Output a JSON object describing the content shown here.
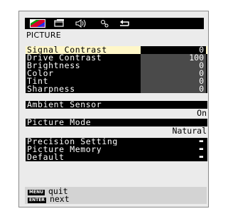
{
  "tabs": [
    {
      "name": "picture-tab-icon",
      "active": true
    },
    {
      "name": "display-tab-icon",
      "active": false
    },
    {
      "name": "audio-tab-icon",
      "active": false
    },
    {
      "name": "setup-tab-icon",
      "active": false
    },
    {
      "name": "return-tab-icon",
      "active": false
    }
  ],
  "section_title": "PICTURE",
  "items": [
    {
      "label": "Signal Contrast",
      "value": "0",
      "selected": true
    },
    {
      "label": "Drive Contrast",
      "value": "100"
    },
    {
      "label": "Brightness",
      "value": "0"
    },
    {
      "label": "Color",
      "value": "0"
    },
    {
      "label": "Tint",
      "value": "0"
    },
    {
      "label": "Sharpness",
      "value": "0"
    }
  ],
  "ambient": {
    "label": "Ambient Sensor",
    "value": "On"
  },
  "mode": {
    "label": "Picture Mode",
    "value": "Natural"
  },
  "submenus": [
    {
      "label": "Precision Setting",
      "arrow": "▬"
    },
    {
      "label": "Picture Memory",
      "arrow": "▬"
    },
    {
      "label": "Default",
      "arrow": "▬"
    }
  ],
  "help": {
    "menu_key": "MENU",
    "menu_text": "quit",
    "enter_key": "ENTER",
    "enter_text": "next"
  },
  "colors": {
    "osd_bg": "#ebebeb",
    "row_bg": "#000000",
    "value_bg": "#4a4a4a",
    "selected_bg": "#fff7c8"
  }
}
